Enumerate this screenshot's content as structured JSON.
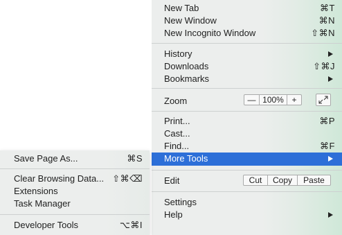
{
  "main_menu": {
    "new_tab": {
      "label": "New Tab",
      "shortcut": "⌘T"
    },
    "new_window": {
      "label": "New Window",
      "shortcut": "⌘N"
    },
    "new_incognito": {
      "label": "New Incognito Window",
      "shortcut": "⇧⌘N"
    },
    "history": {
      "label": "History"
    },
    "downloads": {
      "label": "Downloads",
      "shortcut": "⇧⌘J"
    },
    "bookmarks": {
      "label": "Bookmarks"
    },
    "zoom": {
      "label": "Zoom",
      "minus": "—",
      "value": "100%",
      "plus": "+"
    },
    "print": {
      "label": "Print...",
      "shortcut": "⌘P"
    },
    "cast": {
      "label": "Cast..."
    },
    "find": {
      "label": "Find...",
      "shortcut": "⌘F"
    },
    "more_tools": {
      "label": "More Tools"
    },
    "edit": {
      "label": "Edit",
      "cut": "Cut",
      "copy": "Copy",
      "paste": "Paste"
    },
    "settings": {
      "label": "Settings"
    },
    "help": {
      "label": "Help"
    }
  },
  "sub_menu": {
    "save_page": {
      "label": "Save Page As...",
      "shortcut": "⌘S"
    },
    "clear_browsing": {
      "label": "Clear Browsing Data...",
      "shortcut": "⇧⌘⌫"
    },
    "extensions": {
      "label": "Extensions"
    },
    "task_manager": {
      "label": "Task Manager"
    },
    "developer_tools": {
      "label": "Developer Tools",
      "shortcut": "⌥⌘I"
    }
  },
  "colors": {
    "highlight": "#2d6fd8",
    "menu_bg": "#eceeed",
    "accent_gradient": "#cfe8d8"
  },
  "icons": {
    "submenu_arrow": "triangle-right-icon",
    "fullscreen": "fullscreen-icon"
  }
}
